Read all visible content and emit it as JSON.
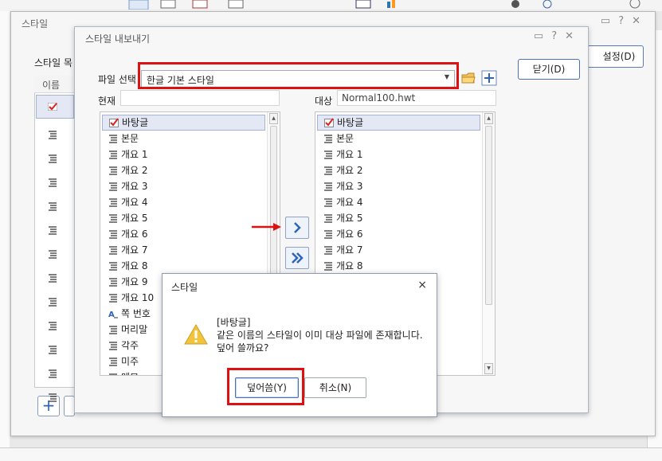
{
  "style_window": {
    "title": "스타일",
    "list_title": "스타일 목",
    "list_header": "이름",
    "setting_button": "설정(D)"
  },
  "export_dialog": {
    "title": "스타일 내보내기",
    "file_select_label": "파일 선택",
    "file_select_value": "한글 기본 스타일",
    "current_label": "현재",
    "current_value": "",
    "target_label": "대상",
    "target_value": "Normal100.hwt",
    "close_button": "닫기(D)",
    "left_items": [
      {
        "label": "바탕글",
        "icon": "checked-style-icon",
        "selected": true
      },
      {
        "label": "본문",
        "icon": "paragraph-style-icon"
      },
      {
        "label": "개요 1",
        "icon": "paragraph-style-icon"
      },
      {
        "label": "개요 2",
        "icon": "paragraph-style-icon"
      },
      {
        "label": "개요 3",
        "icon": "paragraph-style-icon"
      },
      {
        "label": "개요 4",
        "icon": "paragraph-style-icon"
      },
      {
        "label": "개요 5",
        "icon": "paragraph-style-icon"
      },
      {
        "label": "개요 6",
        "icon": "paragraph-style-icon"
      },
      {
        "label": "개요 7",
        "icon": "paragraph-style-icon"
      },
      {
        "label": "개요 8",
        "icon": "paragraph-style-icon"
      },
      {
        "label": "개요 9",
        "icon": "paragraph-style-icon"
      },
      {
        "label": "개요 10",
        "icon": "paragraph-style-icon"
      },
      {
        "label": "쪽 번호",
        "icon": "character-style-icon"
      },
      {
        "label": "머리말",
        "icon": "paragraph-style-icon"
      },
      {
        "label": "각주",
        "icon": "paragraph-style-icon"
      },
      {
        "label": "미주",
        "icon": "paragraph-style-icon"
      },
      {
        "label": "메모",
        "icon": "paragraph-style-icon"
      }
    ],
    "right_items": [
      {
        "label": "바탕글",
        "icon": "checked-style-icon",
        "selected": true
      },
      {
        "label": "본문",
        "icon": "paragraph-style-icon"
      },
      {
        "label": "개요 1",
        "icon": "paragraph-style-icon"
      },
      {
        "label": "개요 2",
        "icon": "paragraph-style-icon"
      },
      {
        "label": "개요 3",
        "icon": "paragraph-style-icon"
      },
      {
        "label": "개요 4",
        "icon": "paragraph-style-icon"
      },
      {
        "label": "개요 5",
        "icon": "paragraph-style-icon"
      },
      {
        "label": "개요 6",
        "icon": "paragraph-style-icon"
      },
      {
        "label": "개요 7",
        "icon": "paragraph-style-icon"
      },
      {
        "label": "개요 8",
        "icon": "paragraph-style-icon"
      }
    ]
  },
  "confirm_dialog": {
    "title": "스타일",
    "close_glyph": "×",
    "message_line1": "[바탕글]",
    "message_line2": "같은 이름의 스타일이 이미 대상 파일에 존재합니다.",
    "message_line3": "덮어 쓸까요?",
    "overwrite_button": "덮어씀(Y)",
    "cancel_button": "취소(N)"
  },
  "colors": {
    "highlight_red": "#dd1111",
    "accent_blue": "#3f63a8"
  }
}
